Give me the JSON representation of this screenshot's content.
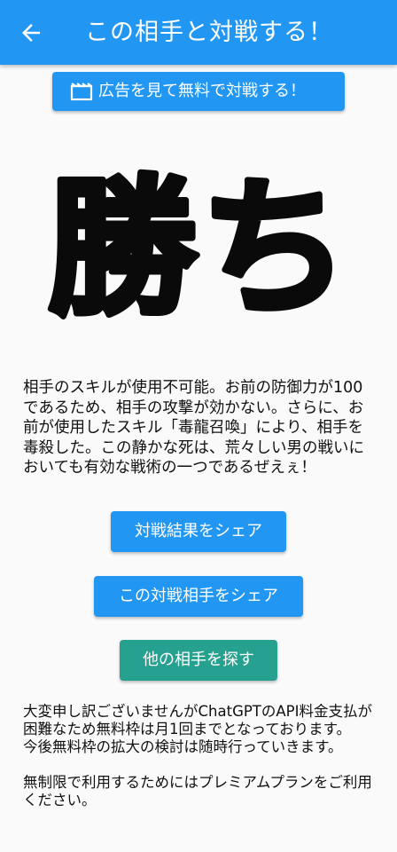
{
  "app_bar": {
    "title": "この相手と対戦する！",
    "back_icon": "arrow-back-icon",
    "color": "#2196f3"
  },
  "ad_button": {
    "label": "広告を見て無料で対戦する！",
    "icon": "film-icon"
  },
  "result": {
    "title": "勝ち",
    "description": "相手のスキルが使用不可能。お前の防御力が100であるため、相手の攻撃が効かない。さらに、お前が使用したスキル「毒龍召喚」により、相手を毒殺した。この静かな死は、荒々しい男の戦いにおいても有効な戦術の一つであるぜえぇ！"
  },
  "buttons": {
    "share_result": "対戦結果をシェア",
    "share_opponent": "この対戦相手をシェア",
    "find_opponent": "他の相手を探す"
  },
  "notice": {
    "line1": "大変申し訳ございませんがChatGPTのAPI料金支払が困難なため無料枠は月1回までとなっております。",
    "line2": "今後無料枠の拡大の検討は随時行っていきます。",
    "line3": "無制限で利用するためにはプレミアムプランをご利用ください。"
  },
  "colors": {
    "primary": "#2196f3",
    "accent_teal": "#26a08f",
    "background": "#fafafa"
  }
}
